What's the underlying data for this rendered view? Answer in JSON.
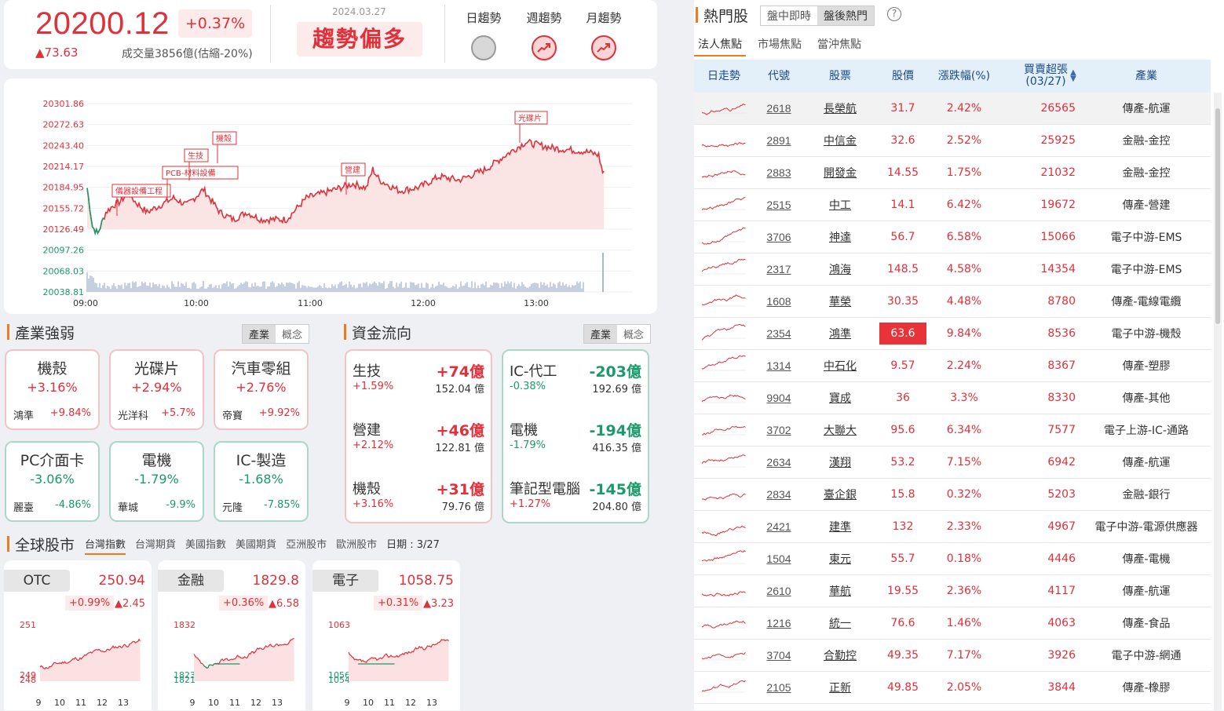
{
  "summary": {
    "index_value": "20200.12",
    "index_pct": "+0.37%",
    "index_change": "▲73.63",
    "volume": "成交量3856億(估縮-20%)",
    "date": "2024.03.27",
    "trend_label": "趨勢偏多",
    "trends": [
      {
        "label": "日趨勢",
        "state": "neutral"
      },
      {
        "label": "週趨勢",
        "state": "up"
      },
      {
        "label": "月趨勢",
        "state": "up"
      }
    ]
  },
  "intraday": {
    "y_ticks": [
      "20301.86",
      "20272.63",
      "20243.40",
      "20214.17",
      "20184.95",
      "20155.72",
      "20126.49",
      "20097.26",
      "20068.03",
      "20038.81"
    ],
    "x_ticks": [
      "09:00",
      "10:00",
      "11:00",
      "12:00",
      "13:00"
    ],
    "annotations": [
      "儀器設備工程",
      "PCB-材料設備",
      "生技",
      "機殼",
      "營建",
      "光碟片"
    ],
    "prev_close": 20126.49
  },
  "industry": {
    "title": "產業強弱",
    "toggle": [
      "產業",
      "概念"
    ],
    "boxes": [
      {
        "name": "機殼",
        "pct": "+3.16%",
        "stock": "鴻準",
        "stock_pct": "+9.84%",
        "dir": "up"
      },
      {
        "name": "光碟片",
        "pct": "+2.94%",
        "stock": "光洋科",
        "stock_pct": "+5.7%",
        "dir": "up"
      },
      {
        "name": "汽車零組",
        "pct": "+2.76%",
        "stock": "帝寶",
        "stock_pct": "+9.92%",
        "dir": "up"
      },
      {
        "name": "PC介面卡",
        "pct": "-3.06%",
        "stock": "麗臺",
        "stock_pct": "-4.86%",
        "dir": "dn"
      },
      {
        "name": "電機",
        "pct": "-1.79%",
        "stock": "華城",
        "stock_pct": "-9.9%",
        "dir": "dn"
      },
      {
        "name": "IC-製造",
        "pct": "-1.68%",
        "stock": "元隆",
        "stock_pct": "-7.85%",
        "dir": "dn"
      }
    ]
  },
  "fund_flow": {
    "title": "資金流向",
    "toggle": [
      "產業",
      "概念"
    ],
    "inflow": [
      {
        "name": "生技",
        "amount": "+74億",
        "pct": "+1.59%",
        "value": "152.04 億"
      },
      {
        "name": "營建",
        "amount": "+46億",
        "pct": "+2.12%",
        "value": "122.81 億"
      },
      {
        "name": "機殼",
        "amount": "+31億",
        "pct": "+3.16%",
        "value": "79.76 億"
      }
    ],
    "outflow": [
      {
        "name": "IC-代工",
        "amount": "-203億",
        "pct": "-0.38%",
        "value": "192.69 億"
      },
      {
        "name": "電機",
        "amount": "-194億",
        "pct": "-1.79%",
        "value": "416.35 億"
      },
      {
        "name": "筆記型電腦",
        "amount": "-145億",
        "pct": "+1.27%",
        "value": "204.80 億"
      }
    ]
  },
  "global": {
    "title": "全球股市",
    "tabs": [
      "台灣指數",
      "台灣期貨",
      "美國指數",
      "美國期貨",
      "亞洲股市",
      "歐洲股市"
    ],
    "date_label": "日期 : 3/27",
    "cards": [
      {
        "name": "OTC",
        "value": "250.94",
        "pct": "+0.99%",
        "change": "▲2.45",
        "y_labels": [
          "251",
          "249",
          "248"
        ],
        "x_labels": [
          "9",
          "10",
          "11",
          "12",
          "13"
        ]
      },
      {
        "name": "金融",
        "value": "1829.8",
        "pct": "+0.36%",
        "change": "▲6.58",
        "y_labels": [
          "1832",
          "1823",
          "1821"
        ],
        "x_labels": [
          "9",
          "10",
          "11",
          "12",
          "13"
        ]
      },
      {
        "name": "電子",
        "value": "1058.75",
        "pct": "+0.31%",
        "change": "▲3.23",
        "y_labels": [
          "1063",
          "1056",
          "1054"
        ],
        "x_labels": [
          "9",
          "10",
          "11",
          "12",
          "13"
        ]
      }
    ]
  },
  "hot": {
    "title": "熱門股",
    "segments": [
      "盤中即時",
      "盤後熱門"
    ],
    "tabs": [
      "法人焦點",
      "市場焦點",
      "當沖焦點"
    ],
    "headers": {
      "spark": "日走勢",
      "code": "代號",
      "name": "股票",
      "price": "股價",
      "pct": "漲跌幅(%)",
      "net": "買賣超張",
      "net_date": "(03/27)",
      "industry": "產業"
    },
    "rows": [
      {
        "code": "2618",
        "name": "長榮航",
        "price": "31.7",
        "pct": "2.42%",
        "net": "26565",
        "industry": "傳產-航運"
      },
      {
        "code": "2891",
        "name": "中信金",
        "price": "32.6",
        "pct": "2.52%",
        "net": "25925",
        "industry": "金融-金控"
      },
      {
        "code": "2883",
        "name": "開發金",
        "price": "14.55",
        "pct": "1.75%",
        "net": "21032",
        "industry": "金融-金控"
      },
      {
        "code": "2515",
        "name": "中工",
        "price": "14.1",
        "pct": "6.42%",
        "net": "19672",
        "industry": "傳產-營建"
      },
      {
        "code": "3706",
        "name": "神達",
        "price": "56.7",
        "pct": "6.58%",
        "net": "15066",
        "industry": "電子中游-EMS"
      },
      {
        "code": "2317",
        "name": "鴻海",
        "price": "148.5",
        "pct": "4.58%",
        "net": "14354",
        "industry": "電子中游-EMS"
      },
      {
        "code": "1608",
        "name": "華榮",
        "price": "30.35",
        "pct": "4.48%",
        "net": "8780",
        "industry": "傳產-電線電纜"
      },
      {
        "code": "2354",
        "name": "鴻準",
        "price": "63.6",
        "pct": "9.84%",
        "net": "8536",
        "industry": "電子中游-機殼",
        "limit": true
      },
      {
        "code": "1314",
        "name": "中石化",
        "price": "9.57",
        "pct": "2.24%",
        "net": "8367",
        "industry": "傳產-塑膠"
      },
      {
        "code": "9904",
        "name": "寶成",
        "price": "36",
        "pct": "3.3%",
        "net": "8330",
        "industry": "傳產-其他"
      },
      {
        "code": "3702",
        "name": "大聯大",
        "price": "95.6",
        "pct": "6.34%",
        "net": "7577",
        "industry": "電子上游-IC-通路"
      },
      {
        "code": "2634",
        "name": "漢翔",
        "price": "53.2",
        "pct": "7.15%",
        "net": "6942",
        "industry": "傳產-航運"
      },
      {
        "code": "2834",
        "name": "臺企銀",
        "price": "15.8",
        "pct": "0.32%",
        "net": "5203",
        "industry": "金融-銀行"
      },
      {
        "code": "2421",
        "name": "建準",
        "price": "132",
        "pct": "2.33%",
        "net": "4967",
        "industry": "電子中游-電源供應器"
      },
      {
        "code": "1504",
        "name": "東元",
        "price": "55.7",
        "pct": "0.18%",
        "net": "4446",
        "industry": "傳產-電機"
      },
      {
        "code": "2610",
        "name": "華航",
        "price": "19.55",
        "pct": "2.36%",
        "net": "4117",
        "industry": "傳產-航運"
      },
      {
        "code": "1216",
        "name": "統一",
        "price": "76.6",
        "pct": "1.46%",
        "net": "4063",
        "industry": "傳產-食品"
      },
      {
        "code": "3704",
        "name": "合勤控",
        "price": "49.35",
        "pct": "7.17%",
        "net": "3926",
        "industry": "電子中游-網通"
      },
      {
        "code": "2105",
        "name": "正新",
        "price": "49.85",
        "pct": "2.05%",
        "net": "3844",
        "industry": "傳產-橡膠"
      }
    ]
  },
  "colors": {
    "up": "#e0303a",
    "down": "#1a9a6a",
    "accent": "#f07a20"
  }
}
